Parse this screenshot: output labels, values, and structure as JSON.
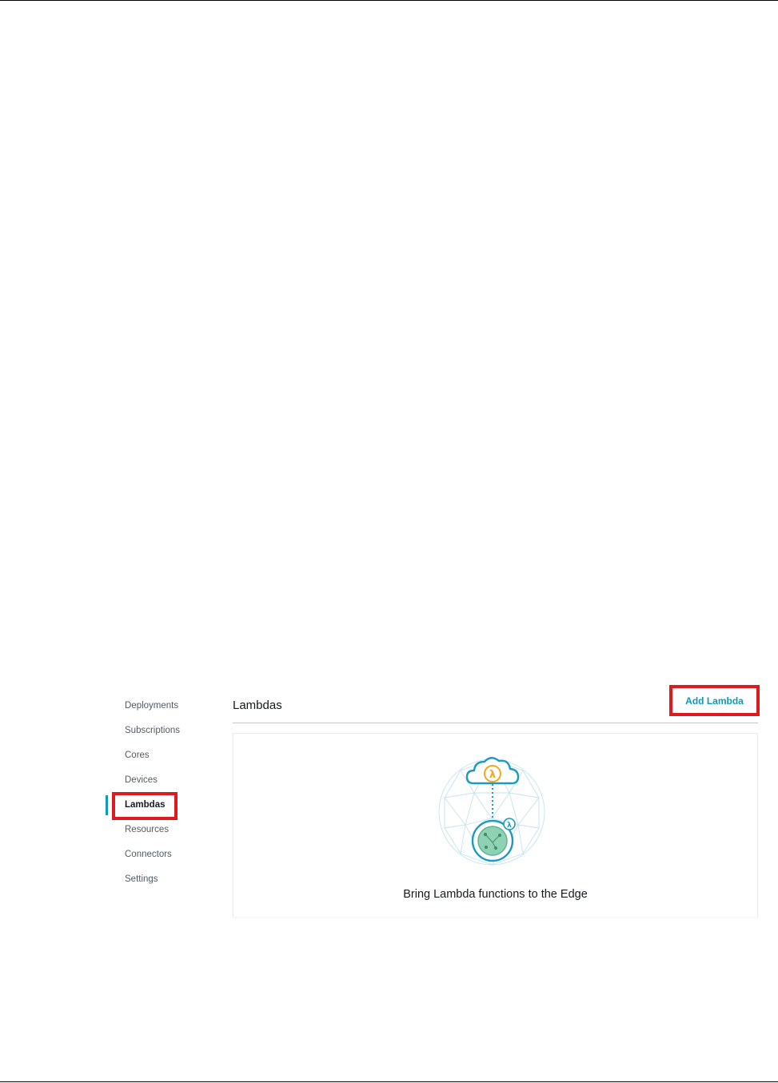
{
  "sidebar": {
    "items": [
      {
        "label": "Deployments"
      },
      {
        "label": "Subscriptions"
      },
      {
        "label": "Cores"
      },
      {
        "label": "Devices"
      },
      {
        "label": "Lambdas"
      },
      {
        "label": "Resources"
      },
      {
        "label": "Connectors"
      },
      {
        "label": "Settings"
      }
    ],
    "active_item": "Lambdas"
  },
  "main": {
    "title": "Lambdas",
    "add_button_label": "Add Lambda",
    "empty_state": {
      "illustration_icon": "lambda-edge-illustration-icon",
      "caption": "Bring Lambda functions to the Edge"
    }
  },
  "colors": {
    "accent": "#0f9ab5",
    "highlight": "#e0191f",
    "lambda_orange": "#f2a71b",
    "device_green": "#7fc7a6"
  }
}
